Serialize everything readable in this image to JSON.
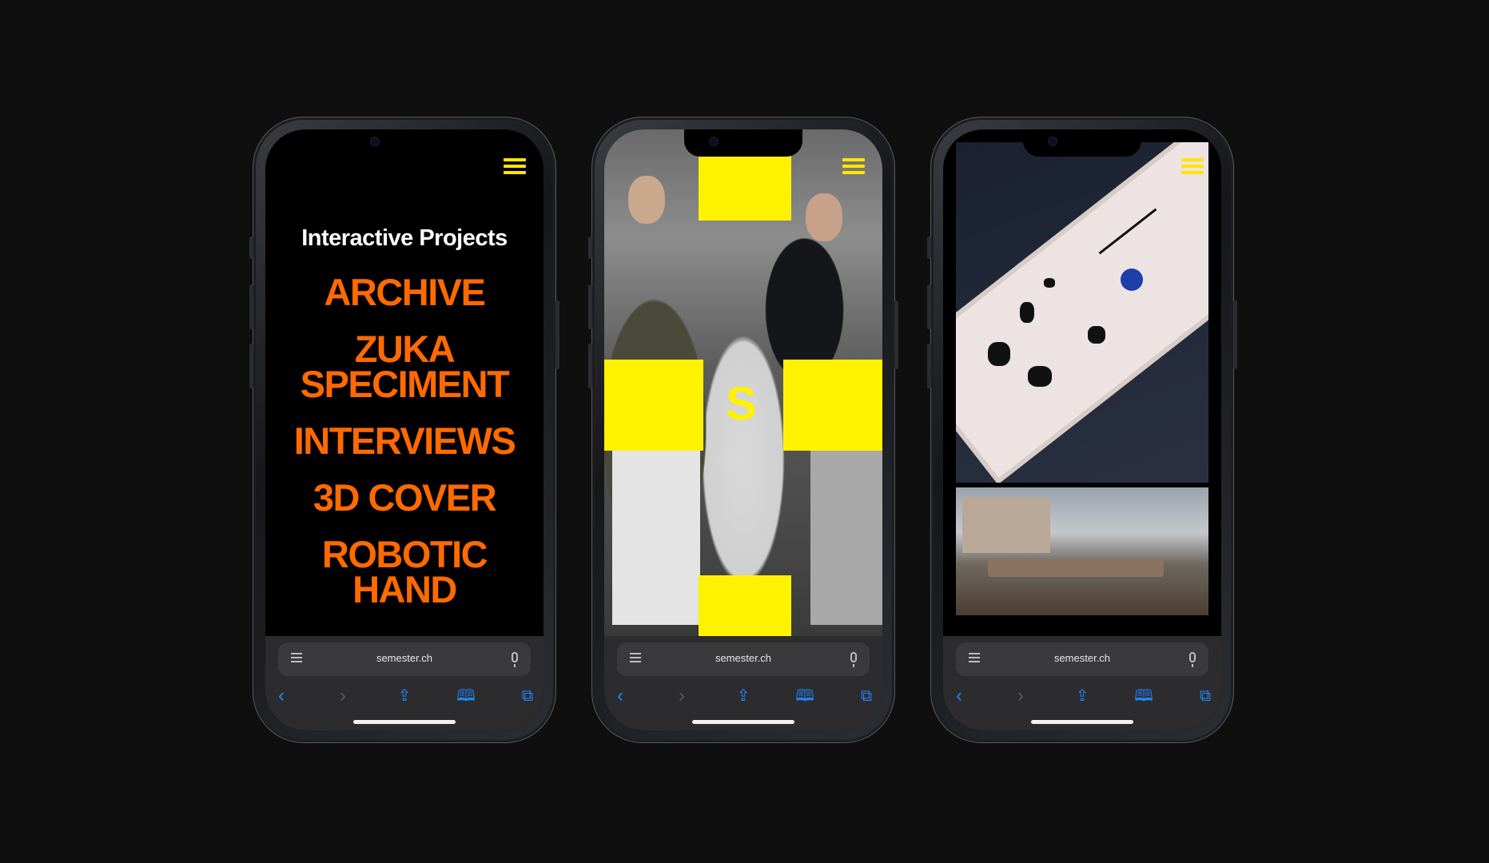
{
  "browser": {
    "url": "semester.ch",
    "toolbar": {
      "back_icon": "chevron-left-icon",
      "forward_icon": "chevron-right-icon",
      "share_icon": "share-icon",
      "bookmarks_icon": "book-icon",
      "tabs_icon": "tabs-icon"
    }
  },
  "phone1": {
    "title": "Interactive Projects",
    "projects": [
      "ARCHIVE",
      "ZUKA\nSPECIMENT",
      "INTERVIEWS",
      "3D COVER",
      "ROBOTIC\nHAND"
    ]
  },
  "phone2": {
    "logo_letter": "S"
  },
  "colors": {
    "accent_orange": "#ff6a00",
    "accent_yellow": "#fff200",
    "background": "#0f0f0f",
    "safari_blue": "#1e87ff"
  }
}
